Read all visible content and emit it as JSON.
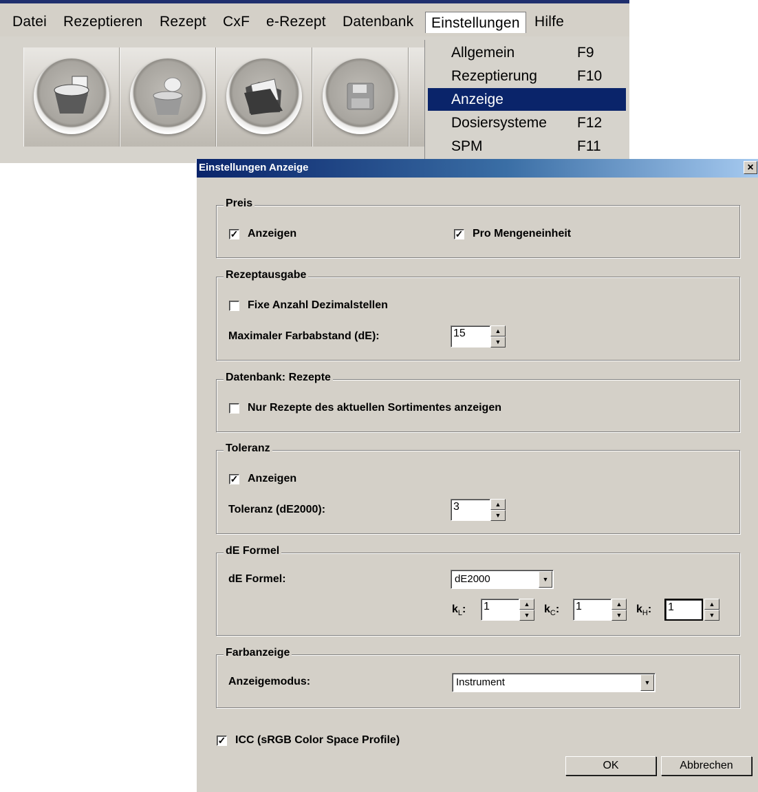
{
  "menu": {
    "items": [
      "Datei",
      "Rezeptieren",
      "Rezept",
      "CxF",
      "e-Rezept",
      "Datenbank",
      "Einstellungen",
      "Hilfe"
    ],
    "open_item": "Einstellungen"
  },
  "toolbar": {
    "icons": [
      "new-recipe-icon",
      "open-recipe-icon",
      "folder-icon",
      "save-icon"
    ]
  },
  "dropdown": {
    "items": [
      {
        "label": "Allgemein",
        "key": "F9"
      },
      {
        "label": "Rezeptierung",
        "key": "F10"
      },
      {
        "label": "Anzeige",
        "key": ""
      },
      {
        "label": "Dosiersysteme",
        "key": "F12"
      },
      {
        "label": "SPM",
        "key": "F11"
      }
    ],
    "selected": "Anzeige"
  },
  "dialog": {
    "title": "Einstellungen Anzeige",
    "close_label": "×",
    "preis": {
      "title": "Preis",
      "anzeigen": {
        "label": "Anzeigen",
        "checked": true
      },
      "pro_mengeneinheit": {
        "label": "Pro Mengeneinheit",
        "checked": true
      }
    },
    "rezeptausgabe": {
      "title": "Rezeptausgabe",
      "fixe_anzahl": {
        "label": "Fixe Anzahl Dezimalstellen",
        "checked": false
      },
      "max_farbabstand_label": "Maximaler Farbabstand (dE):",
      "max_farbabstand_value": "15"
    },
    "datenbank": {
      "title": "Datenbank: Rezepte",
      "nur_rezepte": {
        "label": "Nur Rezepte des aktuellen Sortimentes anzeigen",
        "checked": false
      }
    },
    "toleranz": {
      "title": "Toleranz",
      "anzeigen": {
        "label": "Anzeigen",
        "checked": true
      },
      "toleranz_label": "Toleranz (dE2000):",
      "toleranz_value": "3"
    },
    "de_formel": {
      "title": "dE Formel",
      "label": "dE Formel:",
      "selected": "dE2000",
      "kl_label": "k",
      "kl_sub": "L",
      "kl_value": "1",
      "kc_label": "k",
      "kc_sub": "C",
      "kc_value": "1",
      "kh_label": "k",
      "kh_sub": "H",
      "kh_value": "1"
    },
    "farbanzeige": {
      "title": "Farbanzeige",
      "label": "Anzeigemodus:",
      "selected": "Instrument"
    },
    "icc": {
      "label": "ICC  (sRGB Color Space Profile)",
      "checked": true
    },
    "ok_label": "OK",
    "cancel_label": "Abbrechen",
    "check_mark": "✓"
  }
}
